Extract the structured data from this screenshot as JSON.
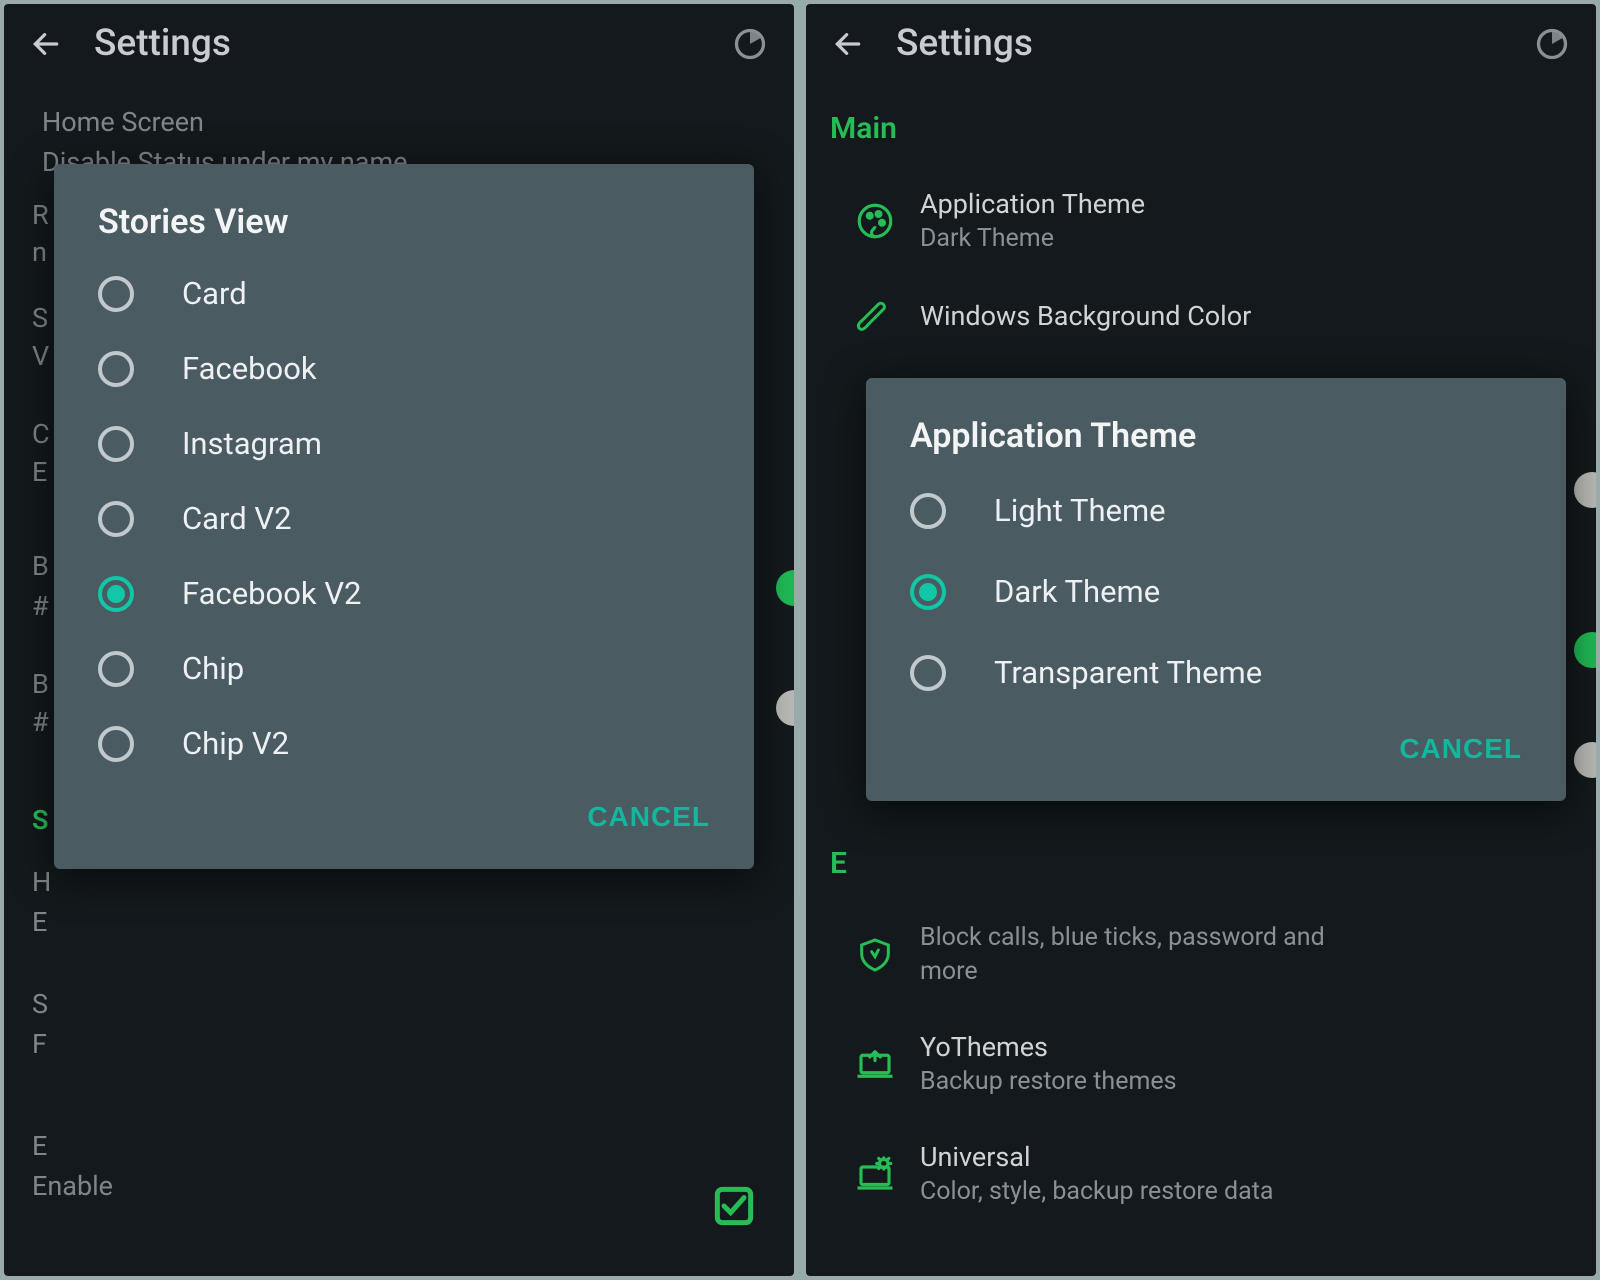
{
  "left": {
    "appbar_title": "Settings",
    "bg": {
      "l1": "Home Screen",
      "l2": "Disable Status under my name",
      "l3": "R",
      "l4": "n",
      "l5": "S",
      "l6": "V",
      "l7": "C",
      "l8": "E",
      "l9": "B",
      "l10": "#",
      "l11": "B",
      "l12": "#",
      "l13": "S",
      "l14": "H",
      "l15": "E",
      "l16": "S",
      "l17": "F",
      "l18": "E",
      "l19": "Enable"
    },
    "dialog": {
      "title": "Stories View",
      "options": [
        "Card",
        "Facebook",
        "Instagram",
        "Card V2",
        "Facebook V2",
        "Chip",
        "Chip V2"
      ],
      "selected_index": 4,
      "cancel": "CANCEL"
    }
  },
  "right": {
    "appbar_title": "Settings",
    "section_main": "Main",
    "items": {
      "app_theme_title": "Application Theme",
      "app_theme_sub": "Dark Theme",
      "win_bg_title": "Windows Background Color",
      "extras_letter": "E",
      "block_sub1": "Block calls, blue ticks, password and",
      "block_sub2": "more",
      "yothemes_title": "YoThemes",
      "yothemes_sub": "Backup restore themes",
      "universal_title": "Universal",
      "universal_sub": "Color, style, backup restore data"
    },
    "dialog": {
      "title": "Application Theme",
      "options": [
        "Light Theme",
        "Dark Theme",
        "Transparent Theme"
      ],
      "selected_index": 1,
      "cancel": "CANCEL"
    }
  }
}
